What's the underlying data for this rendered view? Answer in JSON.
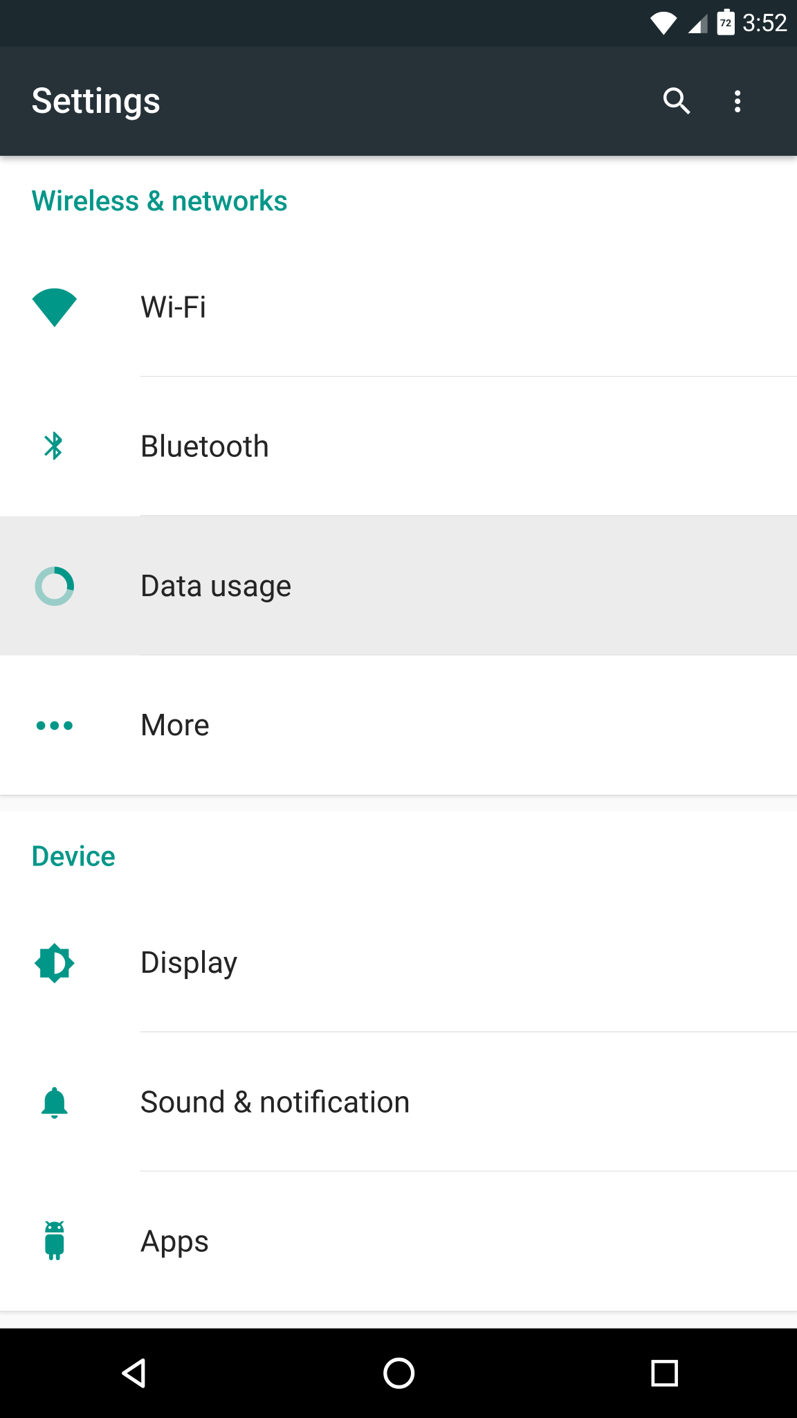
{
  "status": {
    "time": "3:52",
    "battery_percent": "72"
  },
  "header": {
    "title": "Settings"
  },
  "sections": [
    {
      "title": "Wireless & networks",
      "items": [
        {
          "label": "Wi-Fi"
        },
        {
          "label": "Bluetooth"
        },
        {
          "label": "Data usage"
        },
        {
          "label": "More"
        }
      ]
    },
    {
      "title": "Device",
      "items": [
        {
          "label": "Display"
        },
        {
          "label": "Sound & notification"
        },
        {
          "label": "Apps"
        }
      ]
    }
  ]
}
